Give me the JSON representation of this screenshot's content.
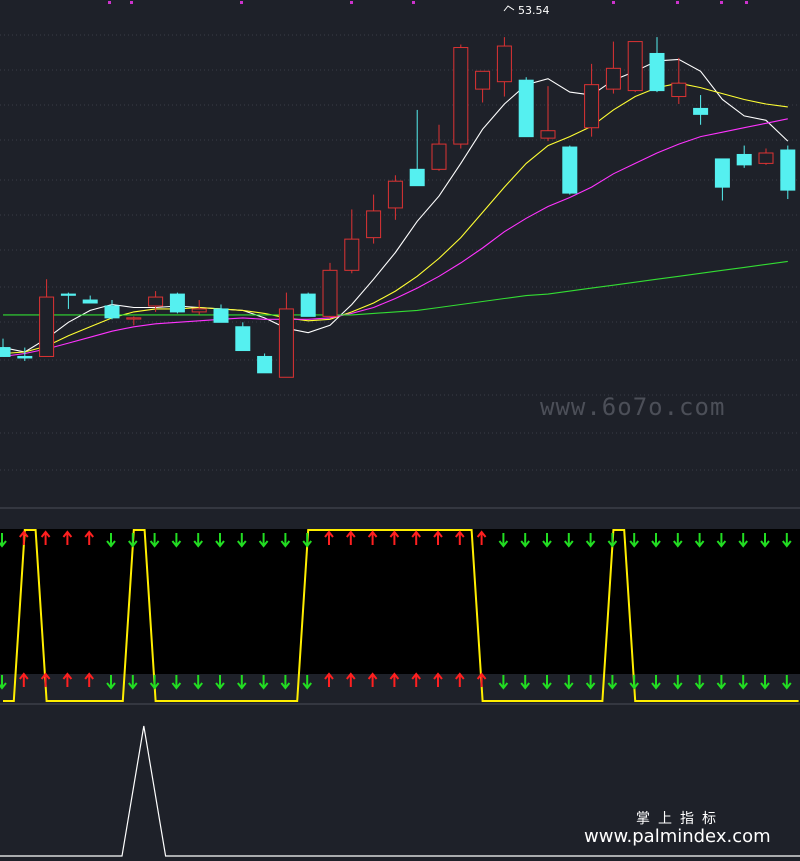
{
  "chart_data": [
    {
      "type": "candlestick",
      "peak_label": "53.54",
      "ylim": [
        22,
        56
      ],
      "candles": [
        {
          "o": 32.6,
          "h": 33.2,
          "l": 32.0,
          "c": 32.0,
          "dir": "down"
        },
        {
          "o": 32.0,
          "h": 32.6,
          "l": 31.7,
          "c": 31.9,
          "dir": "down"
        },
        {
          "o": 32.0,
          "h": 37.2,
          "l": 32.0,
          "c": 36.0,
          "dir": "up"
        },
        {
          "o": 36.2,
          "h": 36.3,
          "l": 35.2,
          "c": 36.2,
          "dir": "down"
        },
        {
          "o": 35.8,
          "h": 36.1,
          "l": 35.6,
          "c": 35.6,
          "dir": "down"
        },
        {
          "o": 35.4,
          "h": 35.8,
          "l": 34.5,
          "c": 34.6,
          "dir": "down"
        },
        {
          "o": 34.6,
          "h": 34.7,
          "l": 34.1,
          "c": 34.6,
          "dir": "up"
        },
        {
          "o": 35.4,
          "h": 36.4,
          "l": 35.0,
          "c": 36.0,
          "dir": "up"
        },
        {
          "o": 36.2,
          "h": 36.3,
          "l": 34.9,
          "c": 35.0,
          "dir": "down"
        },
        {
          "o": 35.0,
          "h": 35.8,
          "l": 34.8,
          "c": 35.2,
          "dir": "up"
        },
        {
          "o": 35.2,
          "h": 35.5,
          "l": 34.3,
          "c": 34.3,
          "dir": "down"
        },
        {
          "o": 34.0,
          "h": 34.3,
          "l": 32.4,
          "c": 32.4,
          "dir": "down"
        },
        {
          "o": 32.0,
          "h": 32.2,
          "l": 30.9,
          "c": 30.9,
          "dir": "down"
        },
        {
          "o": 30.6,
          "h": 36.3,
          "l": 30.6,
          "c": 35.2,
          "dir": "up"
        },
        {
          "o": 36.2,
          "h": 36.3,
          "l": 34.7,
          "c": 34.7,
          "dir": "down"
        },
        {
          "o": 34.7,
          "h": 38.3,
          "l": 34.6,
          "c": 37.8,
          "dir": "up"
        },
        {
          "o": 37.8,
          "h": 41.9,
          "l": 37.6,
          "c": 39.9,
          "dir": "up"
        },
        {
          "o": 40.0,
          "h": 42.9,
          "l": 39.6,
          "c": 41.8,
          "dir": "up"
        },
        {
          "o": 42.0,
          "h": 44.2,
          "l": 41.2,
          "c": 43.8,
          "dir": "up"
        },
        {
          "o": 44.6,
          "h": 48.6,
          "l": 44.6,
          "c": 43.5,
          "dir": "down"
        },
        {
          "o": 44.6,
          "h": 47.6,
          "l": 44.5,
          "c": 46.3,
          "dir": "up"
        },
        {
          "o": 46.3,
          "h": 53.0,
          "l": 46.0,
          "c": 52.8,
          "dir": "up"
        },
        {
          "o": 50.0,
          "h": 51.2,
          "l": 49.1,
          "c": 51.2,
          "dir": "up"
        },
        {
          "o": 50.5,
          "h": 53.5,
          "l": 49.5,
          "c": 52.9,
          "dir": "up"
        },
        {
          "o": 50.6,
          "h": 50.8,
          "l": 46.8,
          "c": 46.8,
          "dir": "down"
        },
        {
          "o": 46.7,
          "h": 50.2,
          "l": 46.5,
          "c": 47.2,
          "dir": "up"
        },
        {
          "o": 46.1,
          "h": 46.2,
          "l": 42.9,
          "c": 43.0,
          "dir": "down"
        },
        {
          "o": 47.4,
          "h": 51.7,
          "l": 46.8,
          "c": 50.3,
          "dir": "up"
        },
        {
          "o": 50.0,
          "h": 53.2,
          "l": 49.7,
          "c": 51.4,
          "dir": "up"
        },
        {
          "o": 49.9,
          "h": 53.2,
          "l": 49.8,
          "c": 53.2,
          "dir": "up"
        },
        {
          "o": 52.4,
          "h": 53.5,
          "l": 49.8,
          "c": 49.9,
          "dir": "down"
        },
        {
          "o": 49.5,
          "h": 52.1,
          "l": 49.0,
          "c": 50.4,
          "dir": "up"
        },
        {
          "o": 48.7,
          "h": 49.6,
          "l": 47.6,
          "c": 48.3,
          "dir": "down"
        },
        {
          "o": 45.3,
          "h": 45.3,
          "l": 42.5,
          "c": 43.4,
          "dir": "down"
        },
        {
          "o": 45.6,
          "h": 46.2,
          "l": 44.7,
          "c": 44.9,
          "dir": "down"
        },
        {
          "o": 45.0,
          "h": 46.0,
          "l": 44.9,
          "c": 45.7,
          "dir": "up"
        },
        {
          "o": 45.9,
          "h": 46.2,
          "l": 42.6,
          "c": 43.2,
          "dir": "down"
        }
      ],
      "ma_lines": [
        {
          "color": "#ffffff",
          "values": [
            32.6,
            32.3,
            33.2,
            34.3,
            35.1,
            35.5,
            35.3,
            35.3,
            35.4,
            35.3,
            35.2,
            35.1,
            34.6,
            33.9,
            33.6,
            34.1,
            35.5,
            37.2,
            39.0,
            41.1,
            42.8,
            45.0,
            47.3,
            49.0,
            50.3,
            50.7,
            49.8,
            49.6,
            50.6,
            51.2,
            51.9,
            52.0,
            51.2,
            49.3,
            48.2,
            47.9,
            46.5
          ]
        },
        {
          "color": "#ffff33",
          "values": [
            32.2,
            32.3,
            32.7,
            33.4,
            34.0,
            34.6,
            35.0,
            35.2,
            35.2,
            35.3,
            35.2,
            35.1,
            34.9,
            34.6,
            34.4,
            34.5,
            35.0,
            35.6,
            36.4,
            37.4,
            38.6,
            40.0,
            41.7,
            43.4,
            45.0,
            46.2,
            46.8,
            47.5,
            48.6,
            49.5,
            50.1,
            50.4,
            50.1,
            49.7,
            49.3,
            49.0,
            48.8
          ]
        },
        {
          "color": "#ff33ff",
          "values": [
            32.0,
            32.2,
            32.5,
            32.9,
            33.3,
            33.7,
            34.0,
            34.2,
            34.3,
            34.4,
            34.5,
            34.6,
            34.5,
            34.5,
            34.5,
            34.6,
            34.9,
            35.3,
            35.9,
            36.6,
            37.4,
            38.3,
            39.3,
            40.4,
            41.3,
            42.1,
            42.7,
            43.4,
            44.3,
            45.0,
            45.7,
            46.3,
            46.8,
            47.1,
            47.4,
            47.7,
            48.0
          ]
        },
        {
          "color": "#33dd33",
          "values": [
            34.8,
            34.8,
            34.8,
            34.8,
            34.8,
            34.8,
            34.8,
            34.8,
            34.8,
            34.8,
            34.8,
            34.8,
            34.8,
            34.8,
            34.8,
            34.8,
            34.8,
            34.9,
            35.0,
            35.1,
            35.3,
            35.5,
            35.7,
            35.9,
            36.1,
            36.2,
            36.4,
            36.6,
            36.8,
            37.0,
            37.2,
            37.4,
            37.6,
            37.8,
            38.0,
            38.2,
            38.4
          ]
        }
      ]
    },
    {
      "type": "line",
      "states": [
        0,
        1,
        0,
        0,
        0,
        0,
        1,
        0,
        0,
        0,
        0,
        0,
        0,
        0,
        1,
        1,
        1,
        1,
        1,
        1,
        1,
        1,
        0,
        0,
        0,
        0,
        0,
        0,
        1,
        0,
        0,
        0,
        0,
        0,
        0,
        0,
        0
      ],
      "arrow_colors": {
        "up": "#ff2020",
        "down": "#22dd22"
      },
      "line_color": "#ffee00"
    },
    {
      "type": "line",
      "values": [
        0,
        0,
        0,
        0,
        0,
        0,
        1,
        0,
        0,
        0,
        0,
        0,
        0,
        0,
        0,
        0,
        0,
        0,
        0,
        0,
        0,
        0,
        0,
        0,
        0,
        0,
        0,
        0,
        0,
        0,
        0,
        0,
        0,
        0,
        0,
        0,
        0
      ],
      "line_color": "#ffffff"
    }
  ],
  "watermark": {
    "site": "www.6o7o.com",
    "cn": "掌上指标",
    "url": "www.palmindex.com"
  },
  "colors": {
    "bg": "#1e2129",
    "up": "#dd3333",
    "down": "#55f0f0",
    "grid": "#3a3d48",
    "magenta_dot": "#cc33cc"
  }
}
